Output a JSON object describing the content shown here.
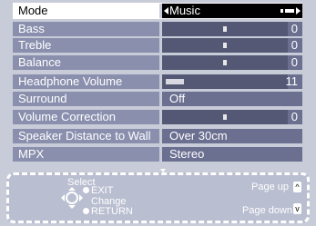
{
  "menu": {
    "rows": [
      {
        "label": "Mode",
        "value": "Music",
        "selected": true
      },
      {
        "label": "Bass",
        "value": "0",
        "level": 0.5
      },
      {
        "label": "Treble",
        "value": "0",
        "level": 0.5
      },
      {
        "label": "Balance",
        "value": "0",
        "level": 0.5
      },
      {
        "label": "Headphone Volume",
        "value": "11",
        "level": 0.18
      },
      {
        "label": "Surround",
        "value": "Off"
      },
      {
        "label": "Volume Correction",
        "value": "0",
        "level": 0.5
      },
      {
        "label": "Speaker Distance to Wall",
        "value": "Over 30cm"
      },
      {
        "label": "MPX",
        "value": "Stereo"
      }
    ]
  },
  "guide": {
    "select": "Select",
    "exit": "EXIT",
    "change": "Change",
    "return": "RETURN",
    "page_up": "Page up",
    "page_down": "Page down",
    "up_glyph": "^",
    "down_glyph": "v"
  },
  "colors": {
    "label_bg": "#8a8fae",
    "control_bg": "#6b6f90",
    "selected_bg": "#ffffff",
    "guide_bg": "#b9bed0"
  }
}
